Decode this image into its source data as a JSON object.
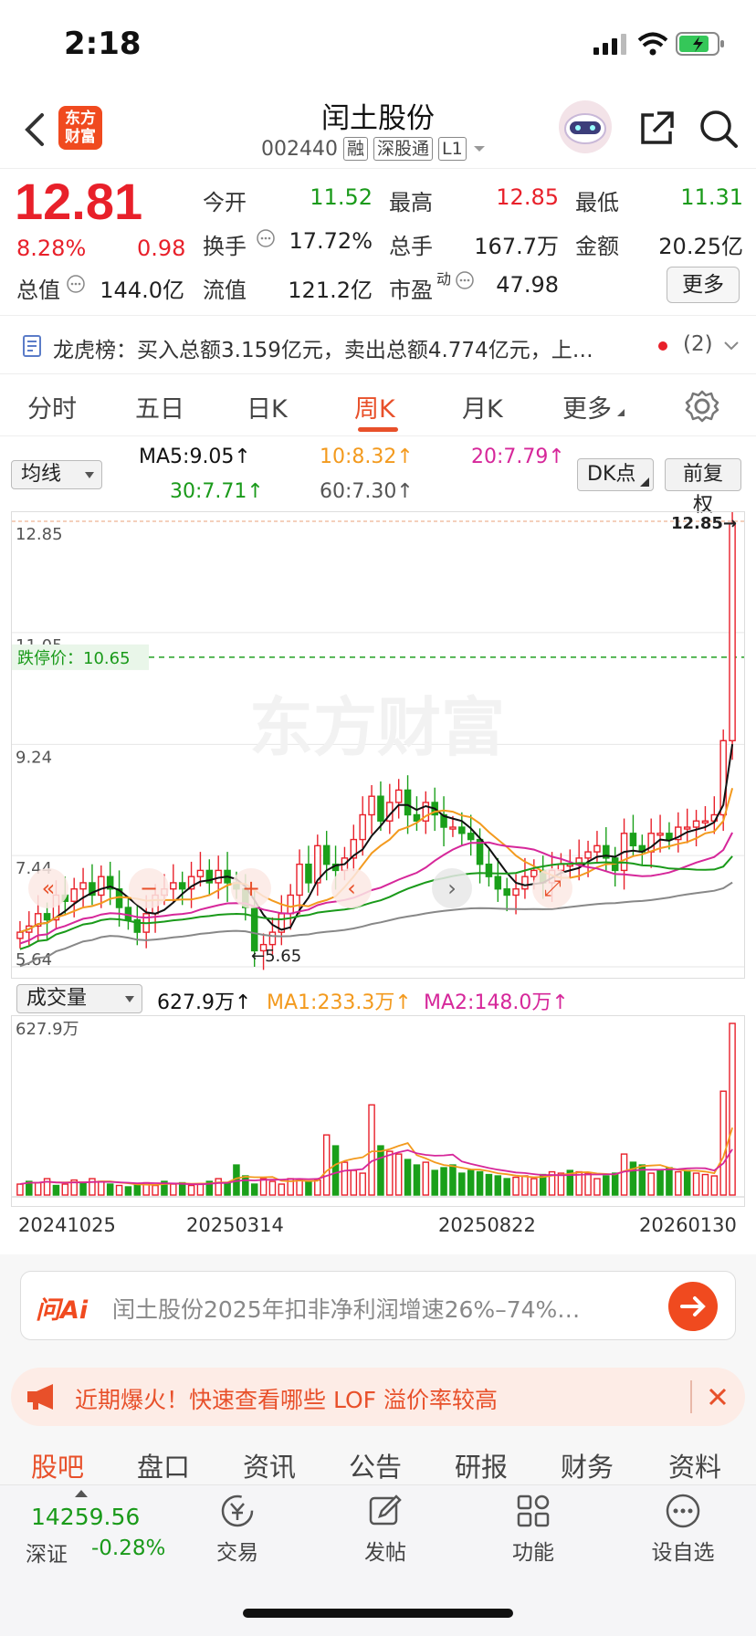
{
  "status": {
    "time": "2:18"
  },
  "header": {
    "title": "闰土股份",
    "code": "002440",
    "tags": [
      "融",
      "深股通",
      "L1"
    ],
    "logo_text": "东方财富"
  },
  "quote": {
    "price": "12.81",
    "change_pct": "8.28%",
    "change": "0.98",
    "open_label": "今开",
    "open": "11.52",
    "high_label": "最高",
    "high": "12.85",
    "low_label": "最低",
    "low": "11.31",
    "turnover_label": "换手",
    "turnover": "17.72%",
    "volume_label": "总手",
    "volume": "167.7万",
    "amount_label": "金额",
    "amount": "20.25亿",
    "mktcap_label": "总值",
    "mktcap": "144.0亿",
    "float_label": "流值",
    "float": "121.2亿",
    "pe_label": "市盈",
    "pe_sup": "动",
    "pe": "47.98",
    "more_label": "更多"
  },
  "dragon": {
    "text": "龙虎榜：买入总额3.159亿元，卖出总额4.774亿元，上…",
    "count": "(2)"
  },
  "tabs": [
    "分时",
    "五日",
    "日K",
    "周K",
    "月K",
    "更多"
  ],
  "active_tab": "周K",
  "ma": {
    "select": "均线",
    "ma5": "MA5:9.05↑",
    "ma10": "10:8.32↑",
    "ma20": "20:7.79↑",
    "ma30": "30:7.71↑",
    "ma60": "60:7.30↑",
    "dk": "DK点",
    "fq": "前复权"
  },
  "chart_data": {
    "type": "candlestick",
    "y_ticks": [
      "12.85",
      "11.05",
      "9.24",
      "7.44",
      "5.64"
    ],
    "ylim": [
      5.64,
      12.85
    ],
    "limit_down_label": "跌停价：10.65",
    "limit_down": 10.65,
    "high_marker": "12.85→",
    "low_marker": "←5.65",
    "watermark": "东方财富",
    "series_colors": {
      "ma5": "#111111",
      "ma10": "#f39a1e",
      "ma20": "#d6279a",
      "ma30": "#1a9a1a",
      "ma60": "#888888"
    },
    "closes": [
      6.2,
      6.3,
      6.5,
      6.4,
      6.8,
      6.7,
      6.9,
      7.0,
      6.8,
      7.1,
      6.9,
      6.6,
      6.4,
      6.2,
      6.5,
      6.8,
      6.9,
      7.0,
      6.9,
      7.1,
      7.2,
      7.0,
      7.2,
      7.0,
      6.9,
      6.6,
      5.9,
      6.0,
      6.2,
      6.5,
      6.8,
      7.3,
      7.0,
      7.6,
      7.3,
      7.2,
      7.4,
      7.7,
      8.1,
      8.4,
      8.0,
      8.3,
      8.5,
      8.1,
      8.0,
      8.3,
      8.1,
      7.9,
      7.9,
      7.8,
      7.7,
      7.3,
      7.1,
      6.9,
      6.8,
      6.9,
      7.1,
      7.2,
      7.0,
      7.2,
      7.3,
      7.3,
      7.4,
      7.5,
      7.6,
      7.4,
      7.2,
      7.8,
      7.6,
      7.5,
      7.8,
      7.8,
      7.7,
      7.9,
      7.9,
      8.0,
      8.0,
      8.1,
      9.3,
      12.81
    ],
    "volume": {
      "select": "成交量",
      "value": "627.9万↑",
      "ma1": "MA1:233.3万↑",
      "ma2": "MA2:148.0万↑",
      "y_max_label": "627.9万",
      "bars": [
        40,
        50,
        45,
        60,
        35,
        40,
        55,
        45,
        60,
        50,
        40,
        35,
        30,
        40,
        45,
        35,
        50,
        40,
        45,
        35,
        40,
        50,
        60,
        45,
        110,
        70,
        40,
        60,
        50,
        40,
        60,
        55,
        50,
        55,
        220,
        180,
        120,
        90,
        80,
        330,
        180,
        160,
        150,
        130,
        110,
        120,
        90,
        100,
        110,
        80,
        90,
        85,
        75,
        70,
        60,
        65,
        70,
        60,
        75,
        85,
        80,
        90,
        85,
        80,
        60,
        70,
        80,
        150,
        120,
        110,
        80,
        90,
        100,
        85,
        90,
        80,
        75,
        70,
        380,
        628
      ],
      "bar_up": [
        true,
        false,
        true,
        true,
        false,
        true,
        true,
        false,
        true,
        true,
        false,
        true,
        false,
        false,
        true,
        true,
        false,
        true,
        false,
        true,
        true,
        false,
        true,
        false,
        false,
        false,
        false,
        true,
        true,
        true,
        true,
        true,
        false,
        true,
        true,
        false,
        true,
        true,
        true,
        true,
        false,
        true,
        true,
        false,
        false,
        true,
        false,
        false,
        false,
        false,
        false,
        false,
        false,
        false,
        false,
        true,
        true,
        true,
        false,
        true,
        true,
        false,
        true,
        true,
        true,
        false,
        false,
        true,
        false,
        false,
        true,
        false,
        false,
        true,
        false,
        true,
        true,
        true,
        true,
        true
      ]
    },
    "x_labels": [
      "20241025",
      "20250314",
      "20250822",
      "20260130"
    ]
  },
  "ai": {
    "badge": "问Ai",
    "text": "闰土股份2025年扣非净利润增速26%–74%…"
  },
  "banner": {
    "text": "近期爆火！快速查看哪些 LOF 溢价率较高"
  },
  "bottom_tabs": [
    "股吧",
    "盘口",
    "资讯",
    "公告",
    "研报",
    "财务",
    "资料"
  ],
  "footer": {
    "index_value": "14259.56",
    "index_name": "深证",
    "index_change": "-0.28%",
    "items": [
      "交易",
      "发帖",
      "功能",
      "设自选"
    ]
  }
}
